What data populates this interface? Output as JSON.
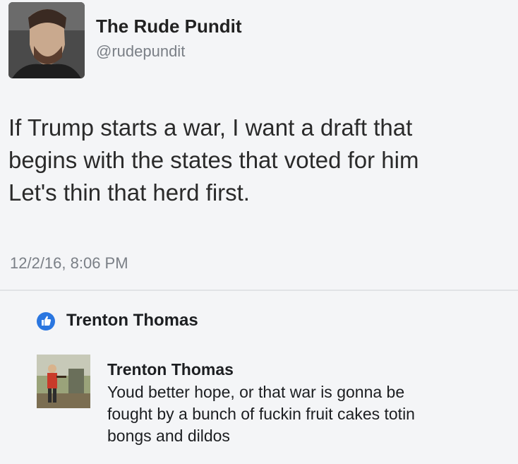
{
  "tweet": {
    "author_name": "The Rude Pundit",
    "handle": "@rudepundit",
    "text_lines": [
      "If Trump starts a war, I want a draft that",
      "begins with the states that voted for him",
      "Let's thin that herd first."
    ],
    "timestamp": "12/2/16, 8:06 PM",
    "avatar_icon": "profile-photo-man"
  },
  "reaction": {
    "icon": "thumbs-up-icon",
    "icon_color": "#2a76e0",
    "name": "Trenton Thomas"
  },
  "comment": {
    "author": "Trenton Thomas",
    "text_lines": [
      "Youd better hope, or that war is gonna be",
      "fought by a bunch of fuckin fruit cakes totin",
      "bongs and dildos"
    ]
  }
}
